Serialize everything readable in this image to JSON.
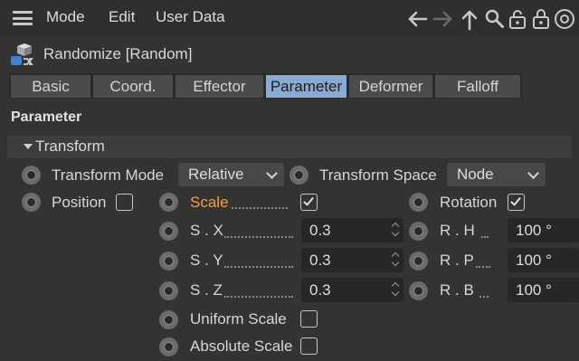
{
  "menu": {
    "items": [
      "Mode",
      "Edit",
      "User Data"
    ]
  },
  "toolbar": {
    "icons": [
      "arrow-left-icon",
      "arrow-right-icon",
      "arrow-up-icon",
      "search-icon",
      "lock-icon",
      "lock-open-icon",
      "target-icon"
    ]
  },
  "object": {
    "title": "Randomize [Random]",
    "icon": "randomize-effector-icon"
  },
  "tabs": [
    {
      "label": "Basic",
      "active": false
    },
    {
      "label": "Coord.",
      "active": false
    },
    {
      "label": "Effector",
      "active": false
    },
    {
      "label": "Parameter",
      "active": true
    },
    {
      "label": "Deformer",
      "active": false
    },
    {
      "label": "Falloff",
      "active": false
    }
  ],
  "section": {
    "title": "Parameter"
  },
  "group": {
    "label": "Transform"
  },
  "transform_mode": {
    "label": "Transform Mode",
    "value": "Relative"
  },
  "transform_space": {
    "label": "Transform Space",
    "value": "Node"
  },
  "position": {
    "label": "Position",
    "checked": false
  },
  "scale": {
    "label": "Scale",
    "checked": true,
    "sx": {
      "label": "S . X",
      "value": "0.3"
    },
    "sy": {
      "label": "S . Y",
      "value": "0.3"
    },
    "sz": {
      "label": "S . Z",
      "value": "0.3"
    },
    "uniform": {
      "label": "Uniform Scale",
      "checked": false
    },
    "absolute": {
      "label": "Absolute Scale",
      "checked": false
    }
  },
  "rotation": {
    "label": "Rotation",
    "checked": true,
    "rh": {
      "label": "R . H",
      "value": "100 °"
    },
    "rp": {
      "label": "R . P",
      "value": "100 °"
    },
    "rb": {
      "label": "R . B",
      "value": "100 °"
    }
  },
  "colors": {
    "accent_tab": "#8aaad3",
    "scale_label": "#f2a03a",
    "background": "#333333"
  }
}
